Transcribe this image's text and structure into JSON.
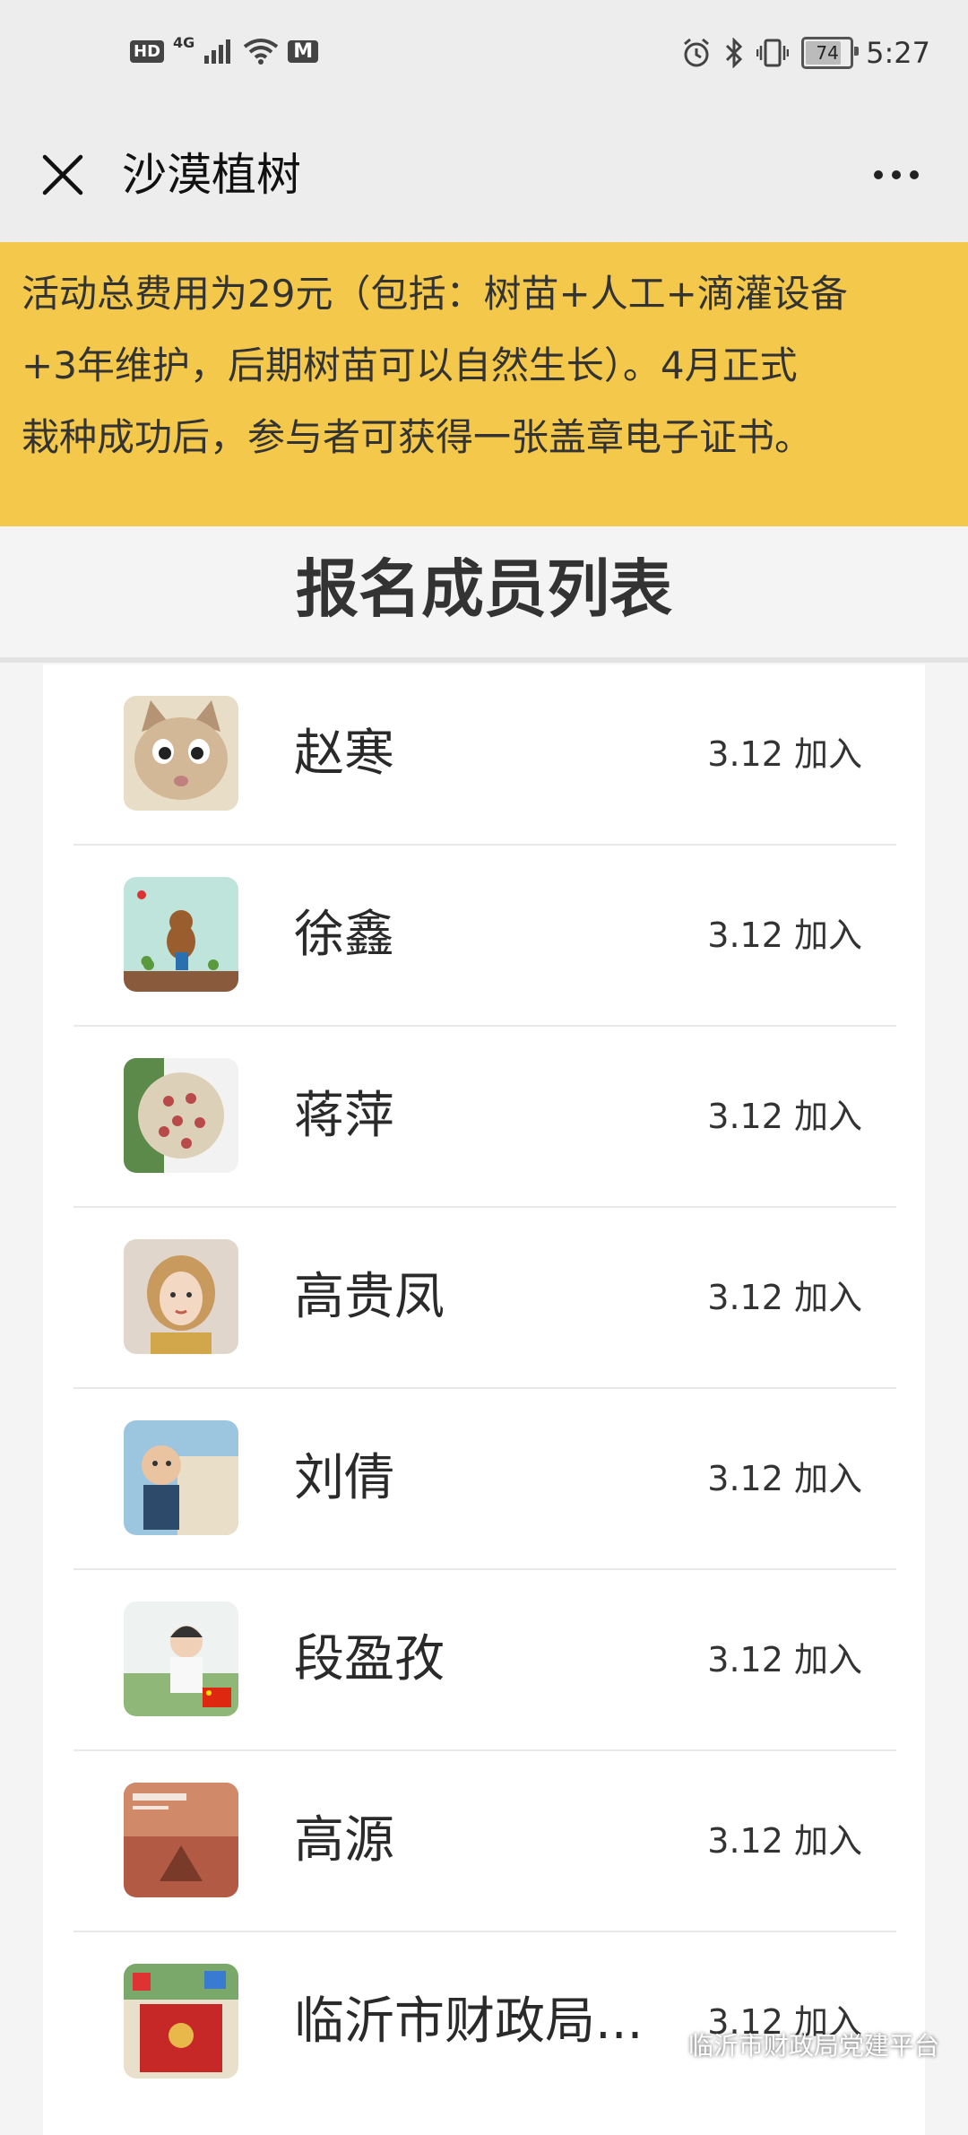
{
  "status_bar": {
    "hd": "HD",
    "network": "4G",
    "m_icon": "M",
    "battery": "74",
    "battery_level": 0.74,
    "time": "5:27"
  },
  "nav": {
    "title": "沙漠植树"
  },
  "notice": {
    "lines": [
      "活动总费用为29元（包括：树苗+人工+滴灌设备",
      "+3年维护，后期树苗可以自然生长）。4月正式",
      "栽种成功后，参与者可获得一张盖章电子证书。"
    ],
    "background": "#f3c84b"
  },
  "list": {
    "heading": "报名成员列表",
    "members": [
      {
        "name": "赵寒",
        "joined": "3.12 加入",
        "avatar": "cat-avatar"
      },
      {
        "name": "徐鑫",
        "joined": "3.12 加入",
        "avatar": "cartoon-bear-avatar"
      },
      {
        "name": "蒋萍",
        "joined": "3.12 加入",
        "avatar": "flower-ball-avatar"
      },
      {
        "name": "高贵凤",
        "joined": "3.12 加入",
        "avatar": "illustrated-woman-avatar"
      },
      {
        "name": "刘倩",
        "joined": "3.12 加入",
        "avatar": "child-photo-avatar"
      },
      {
        "name": "段盈孜",
        "joined": "3.12 加入",
        "avatar": "woman-flag-avatar"
      },
      {
        "name": "高源",
        "joined": "3.12 加入",
        "avatar": "book-cover-avatar"
      },
      {
        "name": "临沂市财政局...",
        "joined": "3.12 加入",
        "avatar": "red-box-avatar"
      }
    ]
  },
  "watermark": "临沂市财政局党建平台"
}
